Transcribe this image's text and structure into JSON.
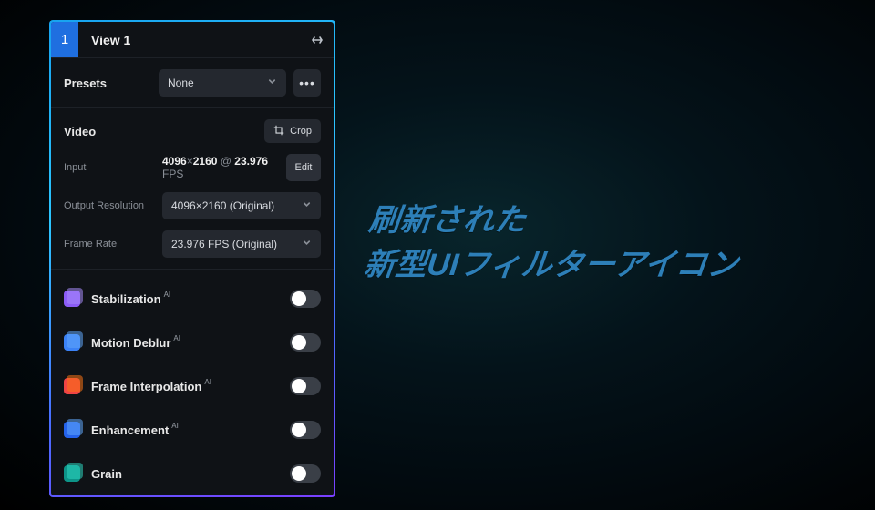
{
  "header": {
    "number": "1",
    "title": "View 1"
  },
  "presets": {
    "label": "Presets",
    "value": "None"
  },
  "video": {
    "label": "Video",
    "crop": "Crop",
    "input_label": "Input",
    "input_w": "4096",
    "input_x": "×",
    "input_h": "2160",
    "input_at": "@",
    "input_fps": "23.976",
    "input_sfx": "FPS",
    "edit": "Edit",
    "outres_label": "Output Resolution",
    "outres_value": "4096×2160 (Original)",
    "fps_label": "Frame Rate",
    "fps_value": "23.976 FPS (Original)"
  },
  "filters": [
    {
      "name": "Stabilization",
      "ai": "AI",
      "icon": "ic-purple",
      "on": false
    },
    {
      "name": "Motion Deblur",
      "ai": "AI",
      "icon": "ic-blue",
      "on": false
    },
    {
      "name": "Frame Interpolation",
      "ai": "AI",
      "icon": "ic-red",
      "on": false
    },
    {
      "name": "Enhancement",
      "ai": "AI",
      "icon": "ic-blue2",
      "on": false
    },
    {
      "name": "Grain",
      "ai": "",
      "icon": "ic-teal",
      "on": false
    }
  ],
  "headline": {
    "line1": "刷新された",
    "line2": "新型UIフィルターアイコン"
  }
}
